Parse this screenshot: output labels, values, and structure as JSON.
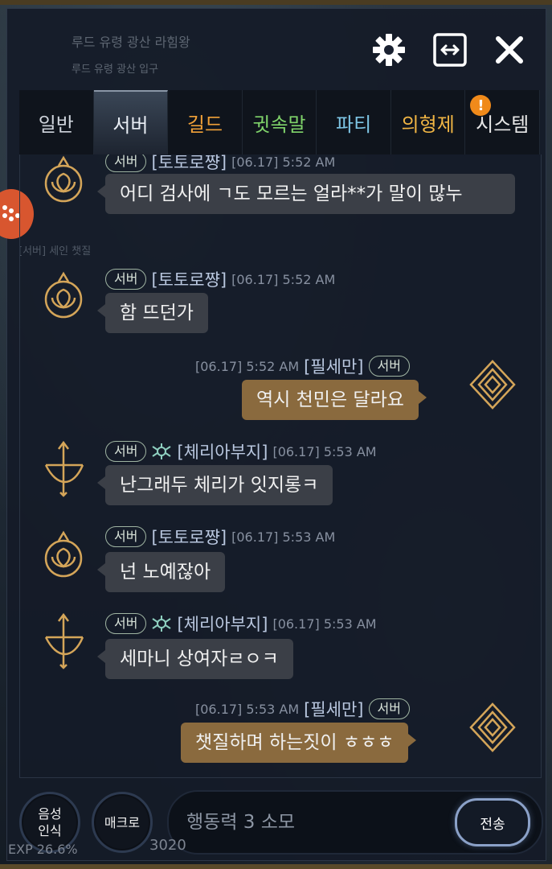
{
  "background": {
    "title_behind": "루드 유령 광산 라힘왕",
    "subtitle_behind": "루드 유령 광산 입구",
    "ghost_text": "[서버] 세인 챗질",
    "exp_text": "EXP 26.6%",
    "gold_text": "3020"
  },
  "header": {
    "settings_icon": "gear-icon",
    "expand_icon": "expand-icon",
    "close_icon": "close-icon"
  },
  "tabs": [
    {
      "label": "일반",
      "color": "#cfd4dc"
    },
    {
      "label": "서버",
      "color": "#e9eef5",
      "active": true
    },
    {
      "label": "길드",
      "color": "#f0a038"
    },
    {
      "label": "귓속말",
      "color": "#7fd36a"
    },
    {
      "label": "파티",
      "color": "#7ec6e6"
    },
    {
      "label": "의형제",
      "color": "#f0b544"
    },
    {
      "label": "시스템",
      "color": "#e8e8e8",
      "badge": "!"
    }
  ],
  "messages": [
    {
      "side": "left",
      "icon": "flower-crest",
      "channel": "서버",
      "name": "[토토로쨩]",
      "time": "[06.17] 5:52 AM",
      "text": "어디 검사에 ㄱ도 모르는 얼라**가 말이 많누"
    },
    {
      "side": "left",
      "icon": "flower-crest",
      "channel": "서버",
      "name": "[토토로쨩]",
      "time": "[06.17] 5:52 AM",
      "text": "함 뜨던가"
    },
    {
      "side": "right",
      "icon": "diamond-crest",
      "channel": "서버",
      "name": "[필세만]",
      "time": "[06.17] 5:52 AM",
      "text": "역시 천민은 달라요"
    },
    {
      "side": "left",
      "icon": "bow-crest",
      "channel": "서버",
      "guild": "guild-crest",
      "name": "[체리아부지]",
      "time": "[06.17] 5:53 AM",
      "text": "난그래두 체리가 잇지롱ㅋ"
    },
    {
      "side": "left",
      "icon": "flower-crest",
      "channel": "서버",
      "name": "[토토로쨩]",
      "time": "[06.17] 5:53 AM",
      "text": "넌 노예잖아"
    },
    {
      "side": "left",
      "icon": "bow-crest",
      "channel": "서버",
      "guild": "guild-crest",
      "name": "[체리아부지]",
      "time": "[06.17] 5:53 AM",
      "text": "세마니 상여자ㄹㅇㅋ"
    },
    {
      "side": "right",
      "icon": "diamond-crest",
      "channel": "서버",
      "name": "[필세만]",
      "time": "[06.17] 5:53 AM",
      "text": "챗질하며 하는짓이 ㅎㅎㅎ"
    }
  ],
  "bottom": {
    "voice_button": "음성 인식",
    "macro_button": "매크로",
    "input_placeholder": "행동력 3 소모",
    "send_button": "전송"
  }
}
